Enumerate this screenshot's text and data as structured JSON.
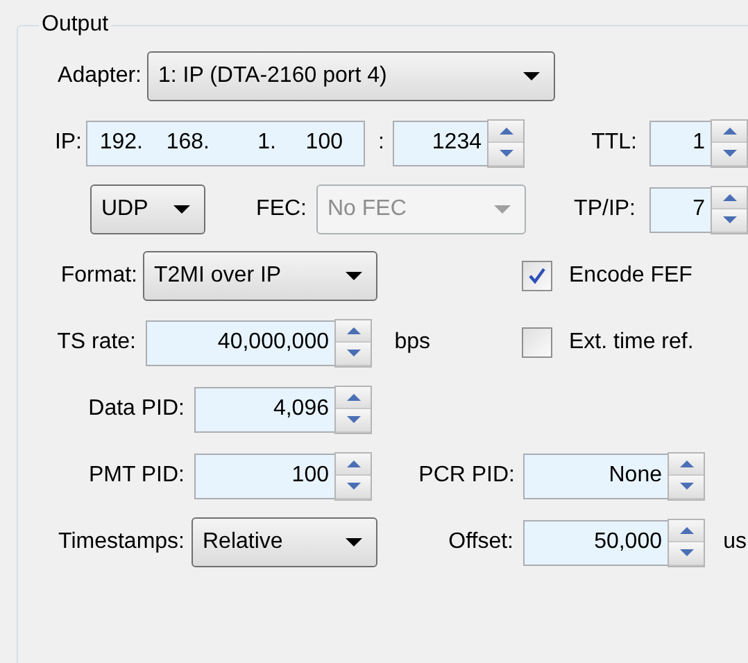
{
  "group": {
    "title": "Output"
  },
  "rows": [
    {
      "items": [
        {
          "kind": "label",
          "text": "Adapter:"
        },
        {
          "kind": "select",
          "value": "1: IP (DTA-2160 port 4)",
          "disabled": false
        }
      ]
    },
    {
      "items": [
        {
          "kind": "label",
          "text": "IP:"
        },
        {
          "kind": "ip",
          "octets": [
            "192.",
            "168.",
            "1.",
            "100"
          ]
        },
        {
          "kind": "label",
          "text": ":"
        },
        {
          "kind": "spin",
          "value": "1234"
        },
        {
          "kind": "label",
          "text": "TTL:"
        },
        {
          "kind": "spin",
          "value": "1"
        }
      ]
    },
    {
      "items": [
        {
          "kind": "select",
          "value": "UDP",
          "disabled": false
        },
        {
          "kind": "label",
          "text": "FEC:"
        },
        {
          "kind": "select",
          "value": "No FEC",
          "disabled": true
        },
        {
          "kind": "label",
          "text": "TP/IP:"
        },
        {
          "kind": "spin",
          "value": "7"
        }
      ]
    },
    {
      "items": [
        {
          "kind": "label",
          "text": "Format:"
        },
        {
          "kind": "select",
          "value": "T2MI over IP",
          "disabled": false
        },
        {
          "kind": "checkbox",
          "label": "Encode FEF",
          "checked": true
        }
      ]
    },
    {
      "items": [
        {
          "kind": "label",
          "text": "TS rate:"
        },
        {
          "kind": "spin",
          "value": "40,000,000"
        },
        {
          "kind": "label",
          "text": "bps"
        },
        {
          "kind": "checkbox",
          "label": "Ext. time ref.",
          "checked": false
        }
      ]
    },
    {
      "items": [
        {
          "kind": "label",
          "text": "Data PID:"
        },
        {
          "kind": "spin",
          "value": "4,096"
        }
      ]
    },
    {
      "items": [
        {
          "kind": "label",
          "text": "PMT PID:"
        },
        {
          "kind": "spin",
          "value": "100"
        },
        {
          "kind": "label",
          "text": "PCR PID:"
        },
        {
          "kind": "spin",
          "value": "None"
        }
      ]
    },
    {
      "items": [
        {
          "kind": "label",
          "text": "Timestamps:"
        },
        {
          "kind": "select",
          "value": "Relative",
          "disabled": false
        },
        {
          "kind": "label",
          "text": "Offset:"
        },
        {
          "kind": "spin",
          "value": "50,000"
        },
        {
          "kind": "label",
          "text": "us"
        }
      ]
    }
  ]
}
